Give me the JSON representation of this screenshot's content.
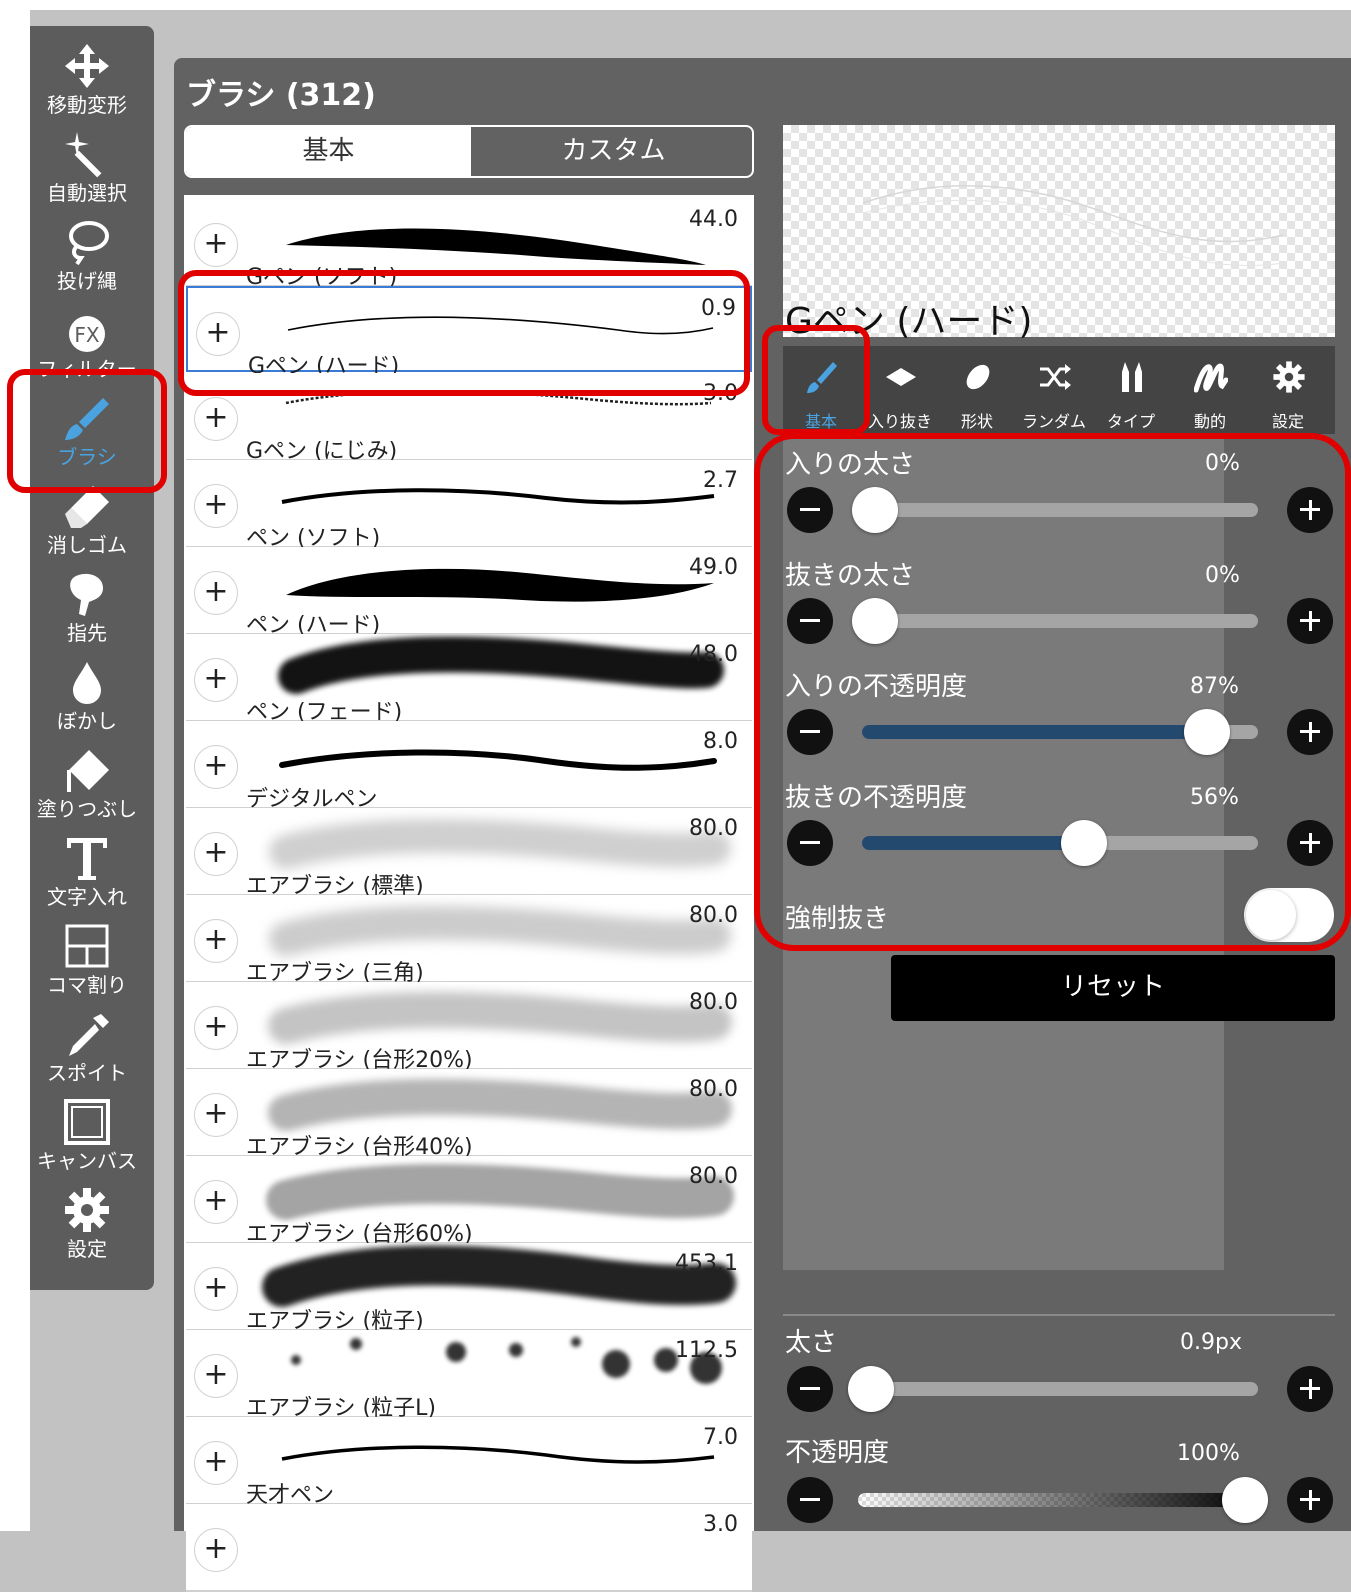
{
  "tools": [
    {
      "label": "移動変形",
      "icon": "move-icon"
    },
    {
      "label": "自動選択",
      "icon": "magic-wand-icon"
    },
    {
      "label": "投げ縄",
      "icon": "lasso-icon"
    },
    {
      "label": "フィルター",
      "icon": "fx-icon"
    },
    {
      "label": "ブラシ",
      "icon": "brush-icon",
      "active": true
    },
    {
      "label": "消しゴム",
      "icon": "eraser-icon"
    },
    {
      "label": "指先",
      "icon": "smudge-finger-icon"
    },
    {
      "label": "ぼかし",
      "icon": "blur-drop-icon"
    },
    {
      "label": "塗りつぶし",
      "icon": "fill-bucket-icon"
    },
    {
      "label": "文字入れ",
      "icon": "text-icon"
    },
    {
      "label": "コマ割り",
      "icon": "frame-divider-icon"
    },
    {
      "label": "スポイト",
      "icon": "eyedropper-icon"
    },
    {
      "label": "キャンバス",
      "icon": "canvas-icon"
    },
    {
      "label": "設定",
      "icon": "gear-icon"
    }
  ],
  "panel": {
    "title": "ブラシ (312)"
  },
  "segment": {
    "basic": "基本",
    "custom": "カスタム"
  },
  "brushes": [
    {
      "name": "Gペン (ソフト)",
      "size": "44.0"
    },
    {
      "name": "Gペン (ハード)",
      "size": "0.9",
      "selected": true
    },
    {
      "name": "Gペン (にじみ)",
      "size": "3.0"
    },
    {
      "name": "ペン (ソフト)",
      "size": "2.7"
    },
    {
      "name": "ペン (ハード)",
      "size": "49.0"
    },
    {
      "name": "ペン (フェード)",
      "size": "48.0"
    },
    {
      "name": "デジタルペン",
      "size": "8.0"
    },
    {
      "name": "エアブラシ (標準)",
      "size": "80.0"
    },
    {
      "name": "エアブラシ (三角)",
      "size": "80.0"
    },
    {
      "name": "エアブラシ (台形20%)",
      "size": "80.0"
    },
    {
      "name": "エアブラシ (台形40%)",
      "size": "80.0"
    },
    {
      "name": "エアブラシ (台形60%)",
      "size": "80.0"
    },
    {
      "name": "エアブラシ (粒子)",
      "size": "453.1"
    },
    {
      "name": "エアブラシ (粒子L)",
      "size": "112.5"
    },
    {
      "name": "天才ペン",
      "size": "7.0"
    },
    {
      "name": "",
      "size": "3.0"
    }
  ],
  "preview": {
    "name": "Gペン (ハード)"
  },
  "tabs": [
    {
      "label": "基本",
      "icon": "brush-icon",
      "active": true
    },
    {
      "label": "入り抜き",
      "icon": "taper-icon"
    },
    {
      "label": "形状",
      "icon": "shape-icon"
    },
    {
      "label": "ランダム",
      "icon": "shuffle-icon"
    },
    {
      "label": "タイプ",
      "icon": "type-icon"
    },
    {
      "label": "動的",
      "icon": "dynamics-icon"
    },
    {
      "label": "設定",
      "icon": "gear-icon"
    }
  ],
  "settings": {
    "sliders": [
      {
        "label": "入りの太さ",
        "value": "0%",
        "level": 0.0
      },
      {
        "label": "抜きの太さ",
        "value": "0%",
        "level": 0.0
      },
      {
        "label": "入りの不透明度",
        "value": "87%",
        "level": 0.87
      },
      {
        "label": "抜きの不透明度",
        "value": "56%",
        "level": 0.56
      }
    ],
    "force_taper": {
      "label": "強制抜き",
      "on": false
    },
    "reset": "リセット"
  },
  "bottom": {
    "size": {
      "label": "太さ",
      "value": "0.9px",
      "level": 0.0
    },
    "opacity": {
      "label": "不透明度",
      "value": "100%",
      "level": 1.0
    }
  },
  "colors": {
    "accent": "#4aa3e0",
    "highlight": "#e00000",
    "slider_fill": "#24496f"
  }
}
